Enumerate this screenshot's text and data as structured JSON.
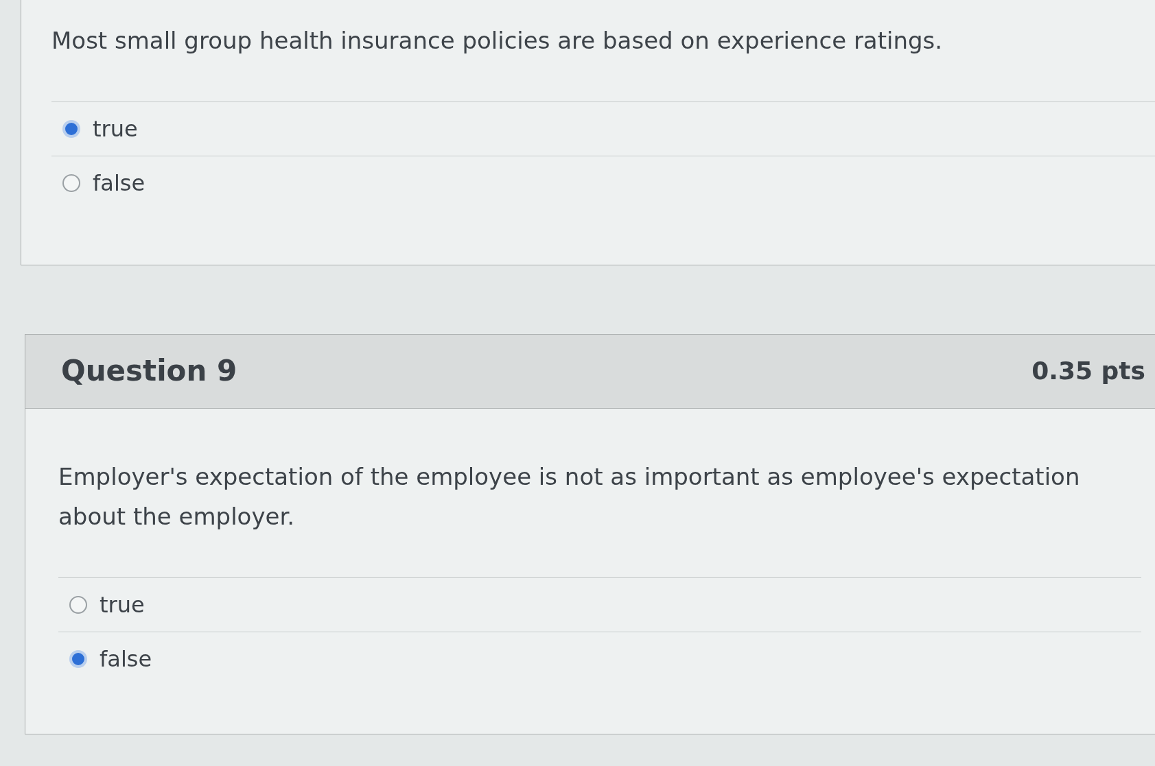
{
  "questions": [
    {
      "text": "Most small group health insurance policies are based on experience ratings.",
      "options": [
        {
          "label": "true",
          "selected": true
        },
        {
          "label": "false",
          "selected": false
        }
      ]
    },
    {
      "title": "Question 9",
      "points": "0.35 pts",
      "text": "Employer's expectation of the employee is not as important as employee's expectation about the employer.",
      "options": [
        {
          "label": "true",
          "selected": false
        },
        {
          "label": "false",
          "selected": true
        }
      ]
    }
  ]
}
